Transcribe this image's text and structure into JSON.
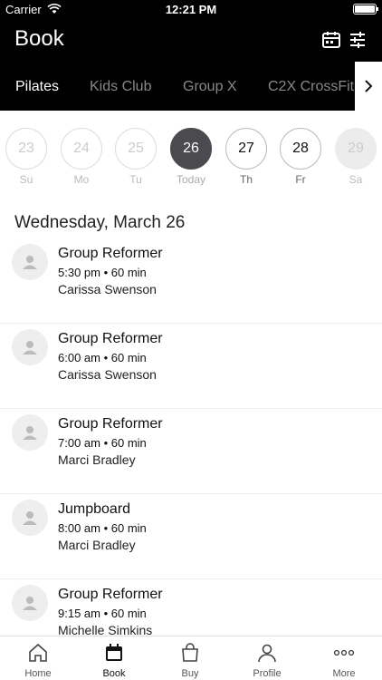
{
  "status_bar": {
    "carrier": "Carrier",
    "time": "12:21 PM"
  },
  "header": {
    "title": "Book",
    "icons": [
      "calendar-icon",
      "filter-icon"
    ]
  },
  "tabs": [
    {
      "label": "Pilates",
      "active": true
    },
    {
      "label": "Kids Club",
      "active": false
    },
    {
      "label": "Group X",
      "active": false
    },
    {
      "label": "C2X CrossFit",
      "active": false
    }
  ],
  "dates": [
    {
      "day": "23",
      "dow": "Su"
    },
    {
      "day": "24",
      "dow": "Mo"
    },
    {
      "day": "25",
      "dow": "Tu"
    },
    {
      "day": "26",
      "dow": "Today"
    },
    {
      "day": "27",
      "dow": "Th"
    },
    {
      "day": "28",
      "dow": "Fr"
    },
    {
      "day": "29",
      "dow": "Sa"
    }
  ],
  "day_heading": "Wednesday, March 26",
  "classes": [
    {
      "name": "Group Reformer",
      "time": "5:30 pm • 60 min",
      "instructor": "Carissa Swenson"
    },
    {
      "name": "Group Reformer",
      "time": "6:00 am • 60 min",
      "instructor": "Carissa Swenson"
    },
    {
      "name": "Group Reformer",
      "time": "7:00 am • 60 min",
      "instructor": "Marci Bradley"
    },
    {
      "name": "Jumpboard",
      "time": "8:00 am • 60 min",
      "instructor": "Marci Bradley"
    },
    {
      "name": "Group Reformer",
      "time": "9:15 am • 60 min",
      "instructor": "Michelle Simkins"
    }
  ],
  "bottom_nav": [
    {
      "label": "Home",
      "icon": "home-icon"
    },
    {
      "label": "Book",
      "icon": "calendar-icon",
      "active": true
    },
    {
      "label": "Buy",
      "icon": "bag-icon"
    },
    {
      "label": "Profile",
      "icon": "profile-icon"
    },
    {
      "label": "More",
      "icon": "more-icon"
    }
  ],
  "colors": {
    "header_bg": "#000000",
    "selected_date": "#4a4a4f"
  }
}
